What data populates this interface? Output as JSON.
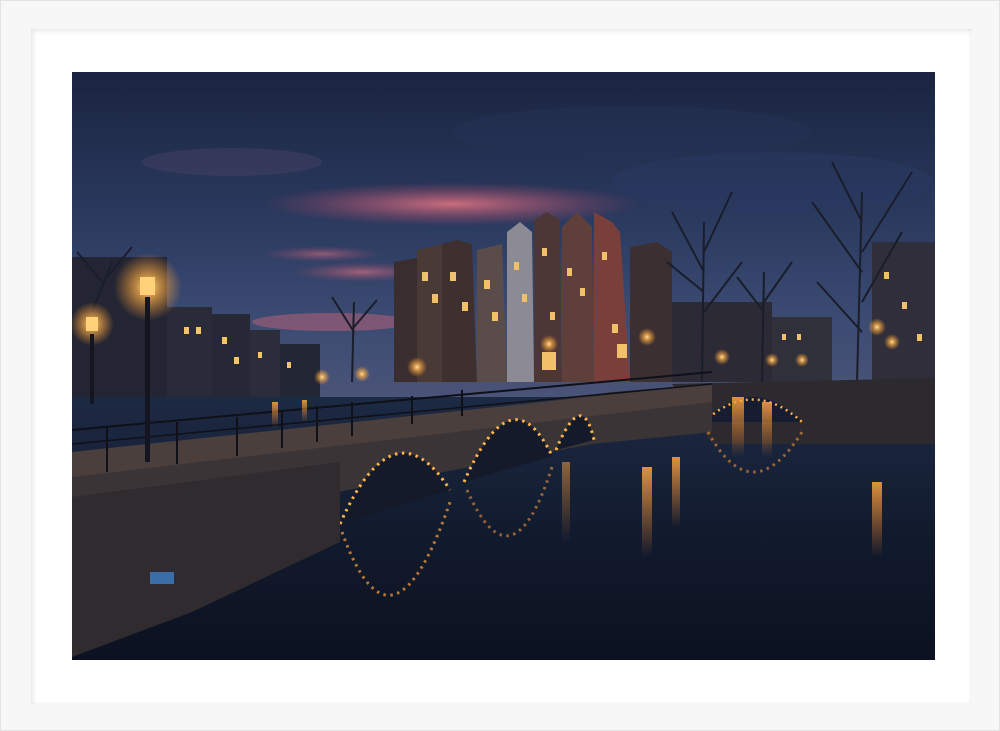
{
  "artwork": {
    "subject": "",
    "palette": {
      "sky_top": "#1c2741",
      "sky_mid": "#2e3d63",
      "cloud_pink": "#e0687a",
      "water": "#111a2c",
      "lamp_glow": "#ffb24a",
      "brick": "#3a3436",
      "frame": "#ffffff"
    }
  }
}
